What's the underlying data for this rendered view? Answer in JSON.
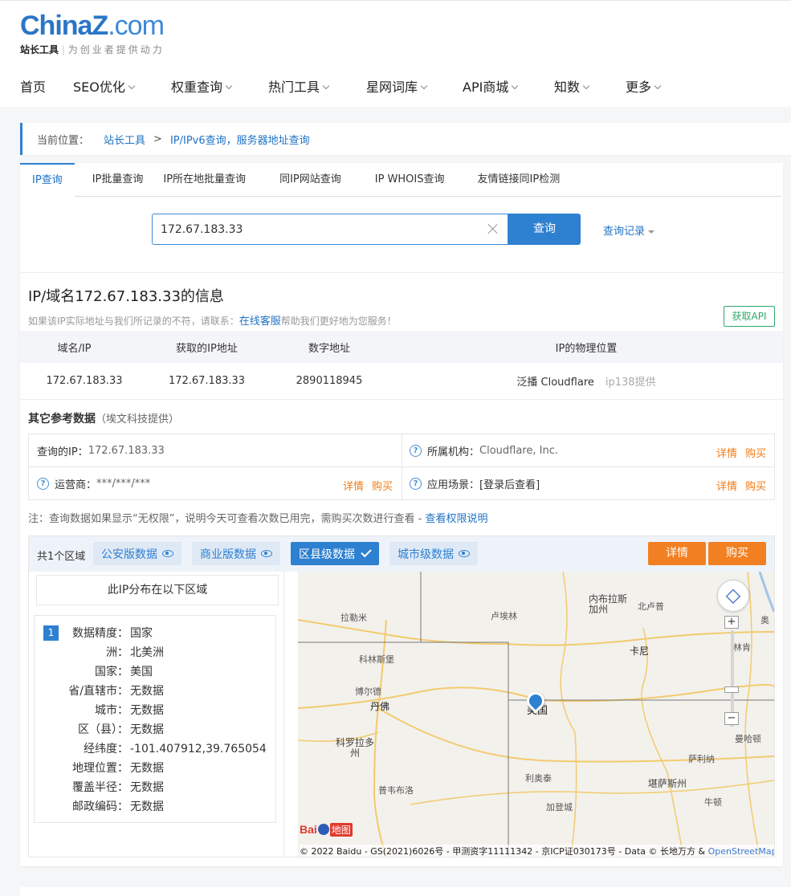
{
  "header": {
    "logo_main": "ChinaZ",
    "logo_suffix": ".com",
    "logo_brand": "站长工具",
    "logo_slogan": "为创业者提供动力",
    "nav": [
      {
        "label": "首页",
        "dropdown": false
      },
      {
        "label": "SEO优化",
        "dropdown": true
      },
      {
        "label": "权重查询",
        "dropdown": true
      },
      {
        "label": "热门工具",
        "dropdown": true
      },
      {
        "label": "星网词库",
        "dropdown": true
      },
      {
        "label": "API商城",
        "dropdown": true
      },
      {
        "label": "知数",
        "dropdown": true
      },
      {
        "label": "更多",
        "dropdown": true
      }
    ]
  },
  "breadcrumb": {
    "label": "当前位置：",
    "home": "站长工具",
    "separator": ">",
    "current": "IP/IPv6查询，服务器地址查询"
  },
  "tabs": [
    "IP查询",
    "IP批量查询",
    "IP所在地批量查询",
    "同IP网站查询",
    "IP WHOIS查询",
    "友情链接同IP检测"
  ],
  "search": {
    "value": "172.67.183.33",
    "button": "查询",
    "history": "查询记录"
  },
  "info": {
    "title": "IP/域名172.67.183.33的信息",
    "note_prefix": "如果该IP实际地址与我们所记录的不符，请联系：",
    "note_link": "在线客服",
    "note_suffix": "帮助我们更好地为您服务！",
    "api_button": "获取API",
    "table_headers": [
      "域名/IP",
      "获取的IP地址",
      "数字地址",
      "IP的物理位置"
    ],
    "row": {
      "domain": "172.67.183.33",
      "ip": "172.67.183.33",
      "numeric": "2890118945",
      "location": "泛播 Cloudflare",
      "source": "ip138提供"
    }
  },
  "reference": {
    "title": "其它参考数据",
    "provider": "（埃文科技提供）",
    "query_ip_label": "查询的IP：",
    "query_ip_value": "172.67.183.33",
    "org_label": "所属机构：",
    "org_value": "Cloudflare, Inc.",
    "isp_label": "运营商：",
    "isp_value": "***/***/***",
    "scene_label": "应用场景：",
    "scene_value": "[登录后查看]",
    "detail": "详情",
    "buy": "购买"
  },
  "notice": {
    "text": "注：查询数据如果显示“无权限”，说明今天可查看次数已用完，需购买次数进行查看 - ",
    "link": "查看权限说明"
  },
  "region": {
    "count": "共1个区域",
    "tabs": [
      {
        "label": "公安版数据",
        "selected": false
      },
      {
        "label": "商业版数据",
        "selected": false
      },
      {
        "label": "区县级数据",
        "selected": true
      },
      {
        "label": "城市级数据",
        "selected": false
      }
    ],
    "detail_button": "详情",
    "buy_button": "购买",
    "dist_title": "此IP分布在以下区域",
    "badge": "1",
    "fields": [
      {
        "k": "数据精度：",
        "v": "国家"
      },
      {
        "k": "洲：",
        "v": "北美洲"
      },
      {
        "k": "国家：",
        "v": "美国"
      },
      {
        "k": "省/直辖市：",
        "v": "无数据"
      },
      {
        "k": "城市：",
        "v": "无数据"
      },
      {
        "k": "区（县）：",
        "v": "无数据"
      },
      {
        "k": "经纬度：",
        "v": "-101.407912,39.765054"
      },
      {
        "k": "地理位置：",
        "v": "无数据"
      },
      {
        "k": "覆盖半径：",
        "v": "无数据"
      },
      {
        "k": "邮政编码：",
        "v": "无数据"
      }
    ]
  },
  "map": {
    "labels": [
      "拉勒米",
      "卢埃林",
      "内布拉斯加州",
      "北卢普",
      "科林斯堡",
      "卡尼",
      "博尔德",
      "丹佛",
      "美国",
      "科罗拉多州",
      "曼哈顿",
      "萨利纳",
      "利奥泰",
      "堪萨斯州",
      "普韦布洛",
      "加登城",
      "牛顿",
      "奥",
      "林肯"
    ],
    "zoom_in": "+",
    "zoom_out": "−",
    "baidu_text": "Bai",
    "baidu_suffix": "地图",
    "copyright": "© 2022 Baidu - GS(2021)6026号 - 甲测资字11111342 - 京ICP证030173号 - Data © 长地万方 & ",
    "osm": "OpenStreetMap"
  },
  "colors": {
    "accent": "#2e80d0",
    "orange": "#f28022",
    "green": "#2ea868"
  }
}
